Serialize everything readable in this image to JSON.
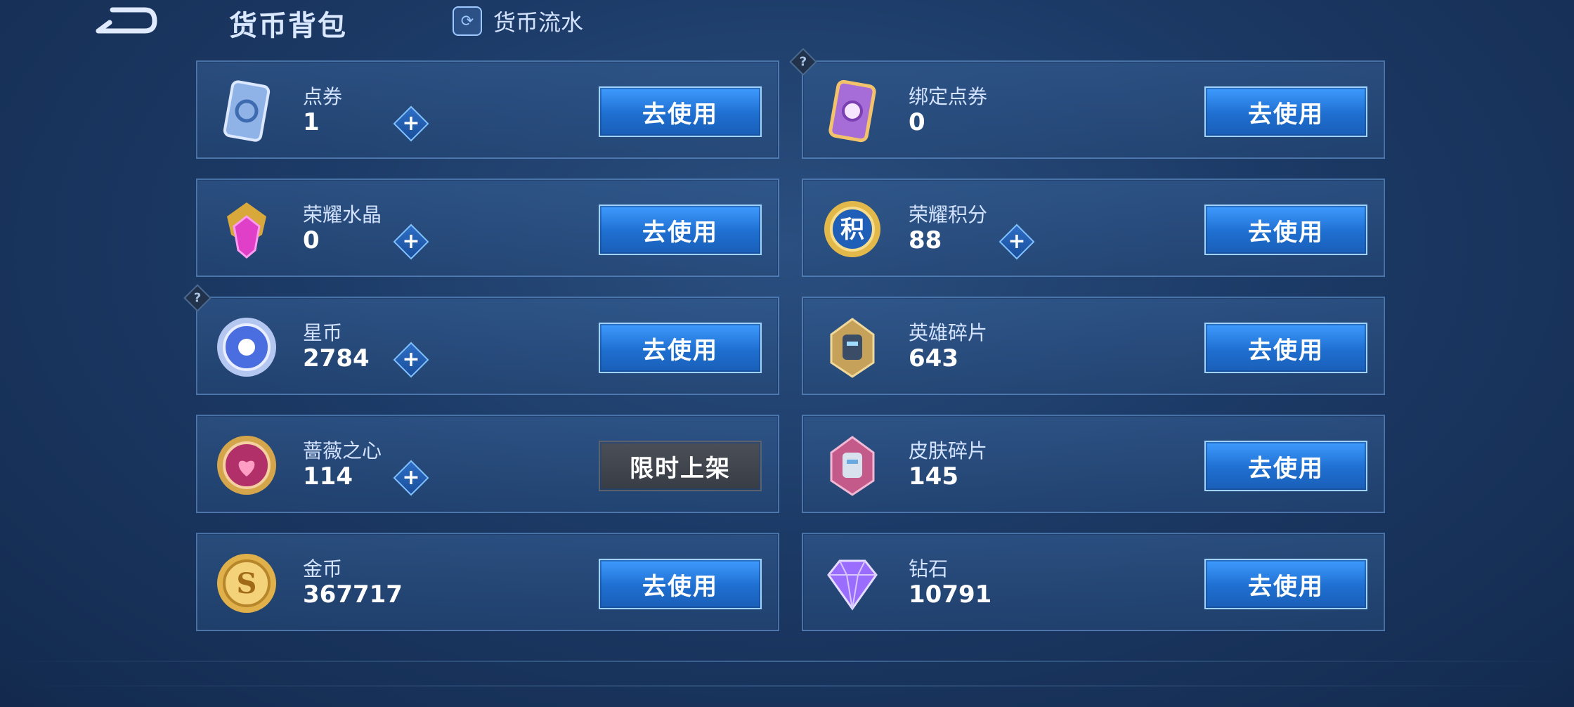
{
  "header": {
    "title": "货币背包",
    "flow_label": "货币流水"
  },
  "action_label": "去使用",
  "limited_label": "限时上架",
  "currencies_left": [
    {
      "name": "点券",
      "amount": "1",
      "icon": "ticket-icon",
      "plus": true,
      "help": false,
      "action": "use"
    },
    {
      "name": "荣耀水晶",
      "amount": "0",
      "icon": "crystal-icon",
      "plus": true,
      "help": false,
      "action": "use"
    },
    {
      "name": "星币",
      "amount": "2784",
      "icon": "star-coin-icon",
      "plus": true,
      "help": true,
      "action": "use"
    },
    {
      "name": "蔷薇之心",
      "amount": "114",
      "icon": "rose-heart-icon",
      "plus": true,
      "help": false,
      "action": "limited"
    },
    {
      "name": "金币",
      "amount": "367717",
      "icon": "gold-coin-icon",
      "plus": false,
      "help": false,
      "action": "use"
    }
  ],
  "currencies_right": [
    {
      "name": "绑定点券",
      "amount": "0",
      "icon": "bound-ticket-icon",
      "plus": false,
      "help": true,
      "action": "use"
    },
    {
      "name": "荣耀积分",
      "amount": "88",
      "icon": "honor-points-icon",
      "plus": true,
      "help": false,
      "action": "use"
    },
    {
      "name": "英雄碎片",
      "amount": "643",
      "icon": "hero-fragment-icon",
      "plus": false,
      "help": false,
      "action": "use"
    },
    {
      "name": "皮肤碎片",
      "amount": "145",
      "icon": "skin-fragment-icon",
      "plus": false,
      "help": false,
      "action": "use"
    },
    {
      "name": "钻石",
      "amount": "10791",
      "icon": "diamond-icon",
      "plus": false,
      "help": false,
      "action": "use"
    }
  ],
  "colors": {
    "accent": "#3f9bff",
    "card_bg": "#2f5688",
    "background": "#1c3a66"
  }
}
